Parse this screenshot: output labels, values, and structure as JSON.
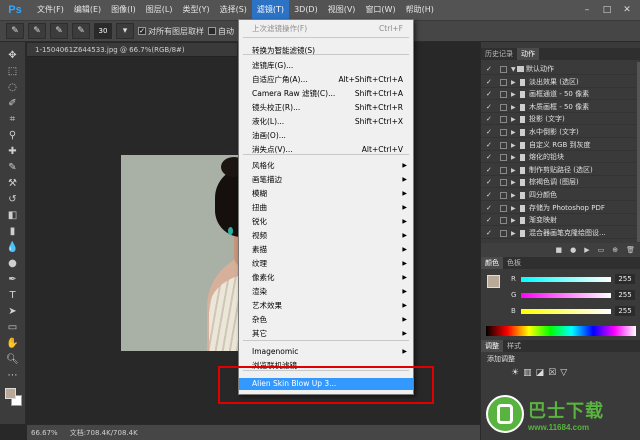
{
  "app": {
    "logo": "Ps"
  },
  "menubar": {
    "items": [
      "文件(F)",
      "编辑(E)",
      "图像(I)",
      "图层(L)",
      "类型(Y)",
      "选择(S)",
      "滤镜(T)",
      "3D(D)",
      "视图(V)",
      "窗口(W)",
      "帮助(H)"
    ],
    "active_index": 6
  },
  "optionsbar": {
    "brush_size": "30",
    "sample_all_layers": "对所有图层取样",
    "auto_enhance": "自动"
  },
  "document": {
    "tab_title": "1-1504061Z644533.jpg @ 66.7%(RGB/8#)",
    "zoom": "66.67%",
    "doc_size": "文档:708.4K/708.4K"
  },
  "filter_menu": {
    "items": [
      {
        "label": "上次滤镜操作(F)",
        "shortcut": "Ctrl+F",
        "disabled": true
      },
      {
        "label": "转换为智能滤镜(S)"
      },
      {
        "label": "滤镜库(G)..."
      },
      {
        "label": "自适应广角(A)...",
        "shortcut": "Alt+Shift+Ctrl+A"
      },
      {
        "label": "Camera Raw 滤镜(C)...",
        "shortcut": "Shift+Ctrl+A"
      },
      {
        "label": "镜头校正(R)...",
        "shortcut": "Shift+Ctrl+R"
      },
      {
        "label": "液化(L)...",
        "shortcut": "Shift+Ctrl+X"
      },
      {
        "label": "油画(O)..."
      },
      {
        "label": "消失点(V)...",
        "shortcut": "Alt+Ctrl+V"
      },
      {
        "label": "风格化",
        "submenu": true
      },
      {
        "label": "画笔描边",
        "submenu": true
      },
      {
        "label": "模糊",
        "submenu": true
      },
      {
        "label": "扭曲",
        "submenu": true
      },
      {
        "label": "锐化",
        "submenu": true
      },
      {
        "label": "视频",
        "submenu": true
      },
      {
        "label": "素描",
        "submenu": true
      },
      {
        "label": "纹理",
        "submenu": true
      },
      {
        "label": "像素化",
        "submenu": true
      },
      {
        "label": "渲染",
        "submenu": true
      },
      {
        "label": "艺术效果",
        "submenu": true
      },
      {
        "label": "杂色",
        "submenu": true
      },
      {
        "label": "其它",
        "submenu": true
      },
      {
        "label": "Imagenomic",
        "submenu": true
      },
      {
        "label": "浏览联机滤镜..."
      },
      {
        "label": "Alien Skin Blow Up 3...",
        "highlight": true
      }
    ]
  },
  "actions_panel": {
    "tabs": [
      "历史记录",
      "动作"
    ],
    "active_tab": 1,
    "rows": [
      {
        "label": "默认动作",
        "folder": true
      },
      {
        "label": "淡出效果 (选区)"
      },
      {
        "label": "画框通道 - 50 像素"
      },
      {
        "label": "木质画框 - 50 像素"
      },
      {
        "label": "投影 (文字)"
      },
      {
        "label": "水中倒影 (文字)"
      },
      {
        "label": "自定义 RGB 到灰度"
      },
      {
        "label": "熔化的铅块"
      },
      {
        "label": "制作剪贴路径 (选区)"
      },
      {
        "label": "棕褐色调 (图层)"
      },
      {
        "label": "四分颜色"
      },
      {
        "label": "存储为 Photoshop PDF"
      },
      {
        "label": "渐变映射"
      },
      {
        "label": "混合器画笔克隆绘图设..."
      }
    ]
  },
  "color_panel": {
    "tabs": [
      "颜色",
      "色板"
    ],
    "channels": [
      {
        "label": "R",
        "value": "255"
      },
      {
        "label": "G",
        "value": "255"
      },
      {
        "label": "B",
        "value": "255"
      }
    ],
    "foreground": "#b9a999"
  },
  "adjust_panel": {
    "tabs": [
      "调整",
      "样式"
    ],
    "title": "添加调整"
  },
  "watermark": {
    "title": "巴士下载",
    "url": "www.11684.com"
  }
}
